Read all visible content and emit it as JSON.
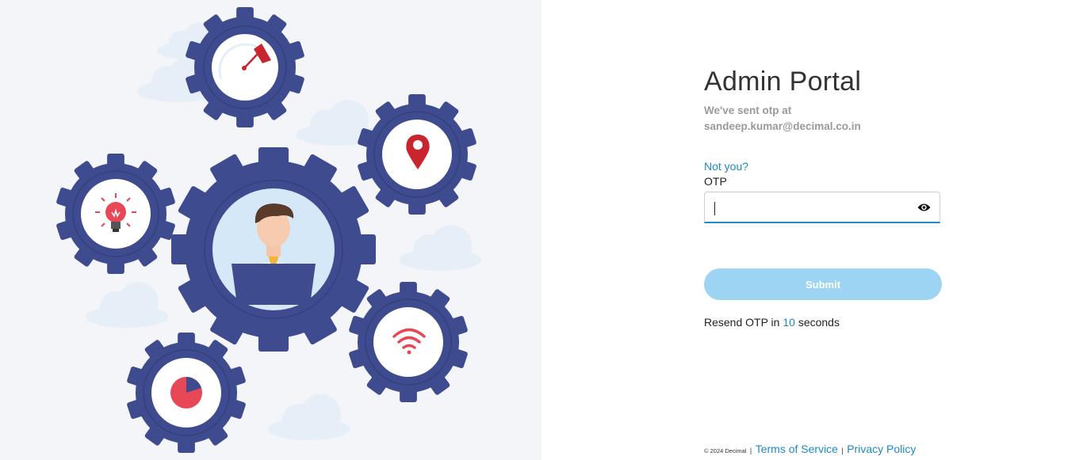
{
  "illustration": {
    "gear_color": "#3f4b8f",
    "ring_color": "#33407d",
    "accent_red": "#e84855",
    "icons": [
      "speedometer-icon",
      "map-pin-icon",
      "light-bulb-icon",
      "user-with-laptop-icon",
      "wifi-icon",
      "pie-chart-icon",
      "cloud-icon"
    ]
  },
  "login": {
    "title": "Admin Portal",
    "sent_line1": "We've sent otp at",
    "email": "sandeep.kumar@decimal.co.in",
    "not_you": "Not you?",
    "otp_label": "OTP",
    "otp_value": "",
    "otp_placeholder": "",
    "submit_label": "Submit",
    "resend_prefix": "Resend OTP in",
    "resend_seconds": "10",
    "resend_suffix": "seconds"
  },
  "footer": {
    "copyright": "© 2024 Decimal",
    "terms": "Terms of Service",
    "privacy": "Privacy Policy",
    "separator": "|"
  },
  "colors": {
    "accent": "#1e88c9",
    "submit_bg": "#9dd4f3",
    "left_bg": "#f3f5f9"
  }
}
